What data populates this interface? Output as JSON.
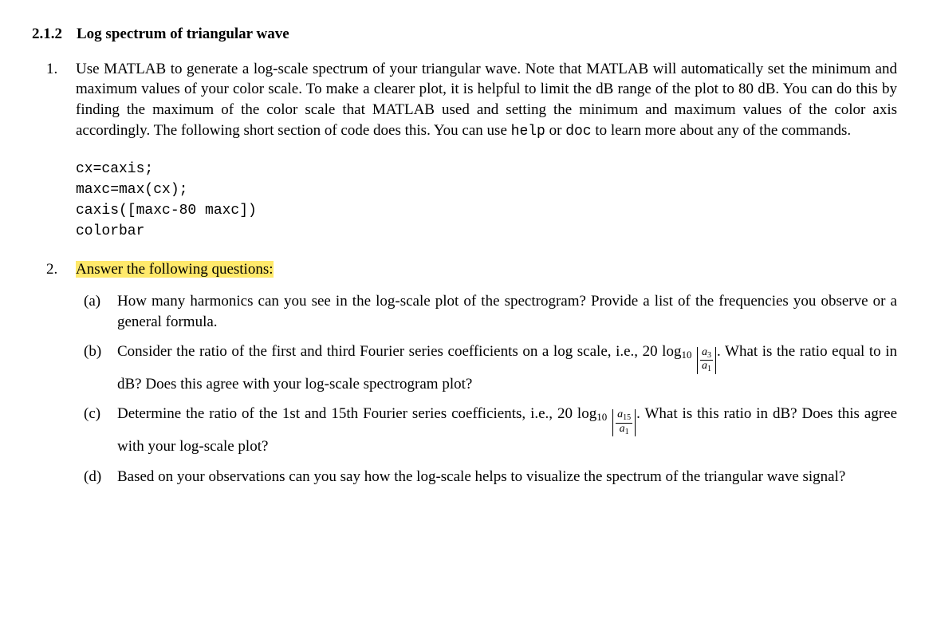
{
  "section": {
    "number": "2.1.2",
    "title": "Log spectrum of triangular wave"
  },
  "items": [
    {
      "marker": "1.",
      "paragraph_parts": [
        "Use MATLAB to generate a log-scale spectrum of your triangular wave. Note that MATLAB will automatically set the minimum and maximum values of your color scale. To make a clearer plot, it is helpful to limit the dB range of the plot to 80 dB. You can do this by finding the maximum of the color scale that MATLAB used and setting the minimum and maximum values of the color axis accordingly. The following short section of code does this. You can use ",
        "help",
        " or ",
        "doc",
        " to learn more about any of the commands."
      ],
      "code_block": "cx=caxis;\nmaxc=max(cx);\ncaxis([maxc-80 maxc])\ncolorbar"
    },
    {
      "marker": "2.",
      "highlight_text": "Answer the following questions:",
      "subitems": [
        {
          "marker": "(a)",
          "text": "How many harmonics can you see in the log-scale plot of the spectrogram? Provide a list of the frequencies you observe or a general formula."
        },
        {
          "marker": "(b)",
          "pre": "Consider the ratio of the first and third Fourier series coefficients on a log scale, i.e., ",
          "math_prefix": "20 log",
          "math_sub": "10",
          "frac_num": "a",
          "frac_num_sub": "3",
          "frac_den": "a",
          "frac_den_sub": "1",
          "post": ". What is the ratio equal to in dB? Does this agree with your log-scale spectrogram plot?"
        },
        {
          "marker": "(c)",
          "pre": "Determine the ratio of the 1st and 15th Fourier series coefficients, i.e., ",
          "math_prefix": "20 log",
          "math_sub": "10",
          "frac_num": "a",
          "frac_num_sub": "15",
          "frac_den": "a",
          "frac_den_sub": "1",
          "post": ". What is this ratio in dB? Does this agree with your log-scale plot?"
        },
        {
          "marker": "(d)",
          "text": "Based on your observations can you say how the log-scale helps to visualize the spectrum of the triangular wave signal?"
        }
      ]
    }
  ]
}
